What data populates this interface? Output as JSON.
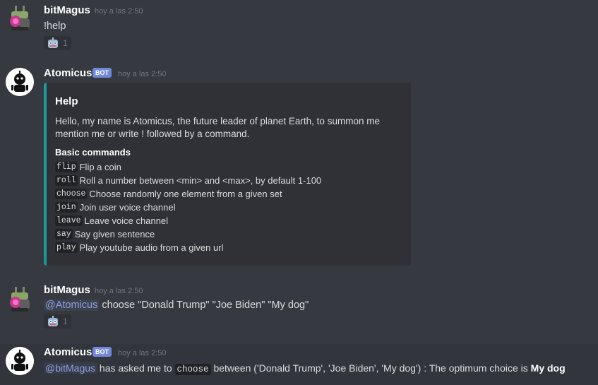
{
  "messages": [
    {
      "author": "bitMagus",
      "timestamp": "hoy a las 2:50",
      "text": "!help",
      "reaction": {
        "icon": "robot-face-icon",
        "count": "1"
      }
    },
    {
      "author": "Atomicus",
      "bot_tag": "BOT",
      "timestamp": "hoy a las 2:50",
      "embed": {
        "accent_color": "#1a9b9b",
        "title": "Help",
        "description": "Hello, my name is Atomicus, the future leader of planet Earth, to summon me mention me or write ! followed by a command.",
        "field_name": "Basic commands",
        "commands": [
          {
            "cmd": "flip",
            "desc": "Flip a coin"
          },
          {
            "cmd": "roll",
            "desc": "Roll a number between <min> and <max>, by default 1-100"
          },
          {
            "cmd": "choose",
            "desc": "Choose randomly one element from a given set"
          },
          {
            "cmd": "join",
            "desc": "Join user voice channel"
          },
          {
            "cmd": "leave",
            "desc": "Leave voice channel"
          },
          {
            "cmd": "say",
            "desc": "Say given sentence"
          },
          {
            "cmd": "play",
            "desc": "Play youtube audio from a given url"
          }
        ]
      }
    },
    {
      "author": "bitMagus",
      "timestamp": "hoy a las 2:50",
      "mention": "@Atomicus",
      "text": " choose \"Donald Trump\" \"Joe Biden\"  \"My dog\"",
      "reaction": {
        "icon": "robot-face-icon",
        "count": "1"
      }
    },
    {
      "author": "Atomicus",
      "bot_tag": "BOT",
      "timestamp": "hoy a las 2:50",
      "mention": "@bitMagus",
      "text_before": " has asked me to ",
      "code": "choose",
      "text_after": " between ('Donald Trump', 'Joe Biden', 'My dog') : The optimum choice is ",
      "bold": "My dog"
    }
  ],
  "colors": {
    "background": "#36393f",
    "mention": "#8ea1e1",
    "bot_tag": "#7289da",
    "embed_bg": "#2f3136"
  }
}
